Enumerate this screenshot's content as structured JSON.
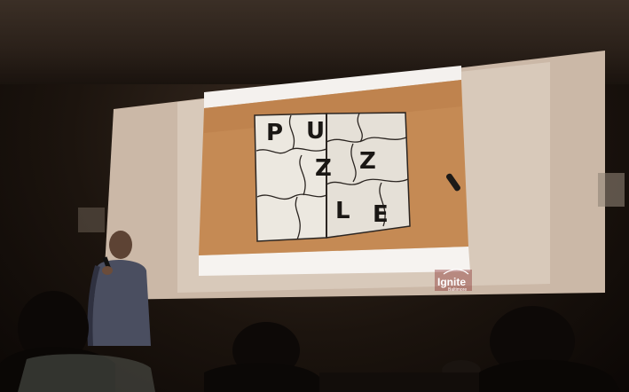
{
  "slide": {
    "letters": [
      "P",
      "U",
      "Z",
      "Z",
      "L",
      "E"
    ]
  },
  "logo": {
    "brand": "Ignite",
    "subtitle": "Baltimore"
  },
  "colors": {
    "screen": "#e9e2db",
    "slide_wood": "#c58a54",
    "paper": "#ece8e0",
    "logo_red": "#c8102e"
  }
}
